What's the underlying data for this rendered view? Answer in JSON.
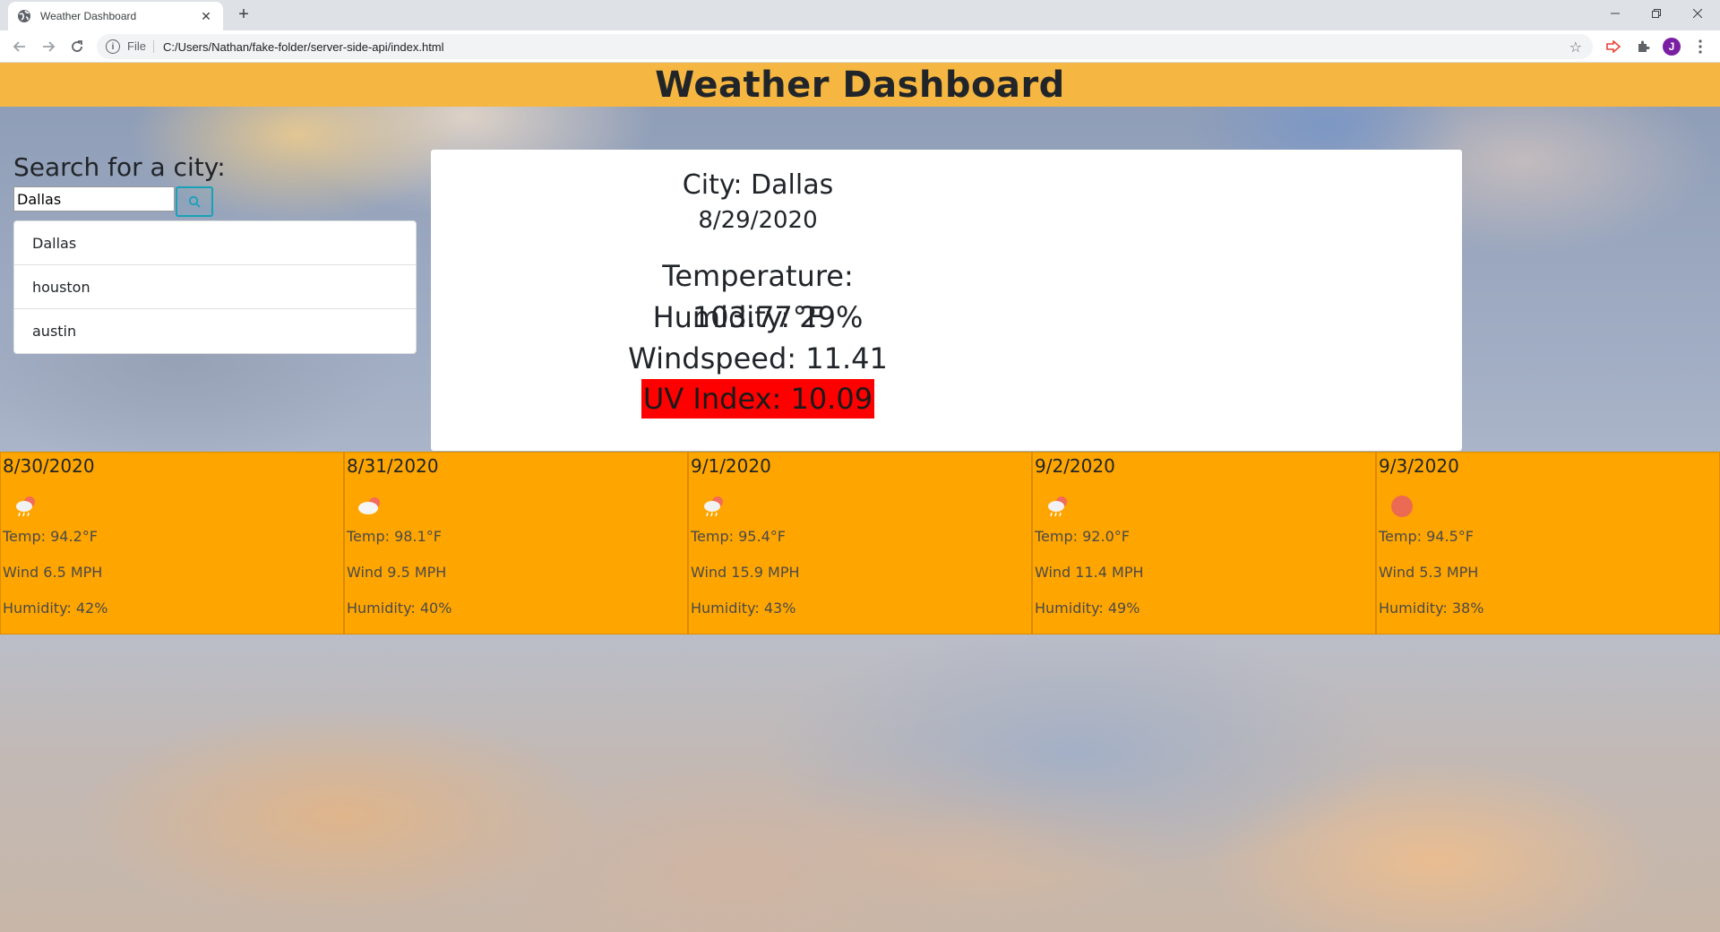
{
  "browser": {
    "tab_title": "Weather Dashboard",
    "new_tab": "+",
    "scheme": "File",
    "url": "C:/Users/Nathan/fake-folder/server-side-api/index.html",
    "avatar_letter": "J"
  },
  "header": {
    "title": "Weather Dashboard"
  },
  "search": {
    "label": "Search for a city:",
    "value": "Dallas",
    "history": [
      "Dallas",
      "houston",
      "austin"
    ]
  },
  "current": {
    "city": "City: Dallas",
    "date": "8/29/2020",
    "temperature": "Temperature: 103.77°F",
    "humidity": "Humidity: 29%",
    "windspeed": "Windspeed: 11.41 MPH",
    "uv": "UV Index: 10.09",
    "uv_color": "#ff0000"
  },
  "forecast": [
    {
      "date": "8/30/2020",
      "icon": "rain-cloud-icon",
      "temp": "Temp: 94.2°F",
      "wind": "Wind 6.5 MPH",
      "humidity": "Humidity: 42%"
    },
    {
      "date": "8/31/2020",
      "icon": "cloud-sun-icon",
      "temp": "Temp: 98.1°F",
      "wind": "Wind 9.5 MPH",
      "humidity": "Humidity: 40%"
    },
    {
      "date": "9/1/2020",
      "icon": "rain-cloud-icon",
      "temp": "Temp: 95.4°F",
      "wind": "Wind 15.9 MPH",
      "humidity": "Humidity: 43%"
    },
    {
      "date": "9/2/2020",
      "icon": "rain-cloud-icon",
      "temp": "Temp: 92.0°F",
      "wind": "Wind 11.4 MPH",
      "humidity": "Humidity: 49%"
    },
    {
      "date": "9/3/2020",
      "icon": "sun-icon",
      "temp": "Temp: 94.5°F",
      "wind": "Wind 5.3 MPH",
      "humidity": "Humidity: 38%"
    }
  ],
  "colors": {
    "header_bg": "#f5b642",
    "forecast_bg": "#ffa500",
    "uv_high": "#ff0000"
  }
}
